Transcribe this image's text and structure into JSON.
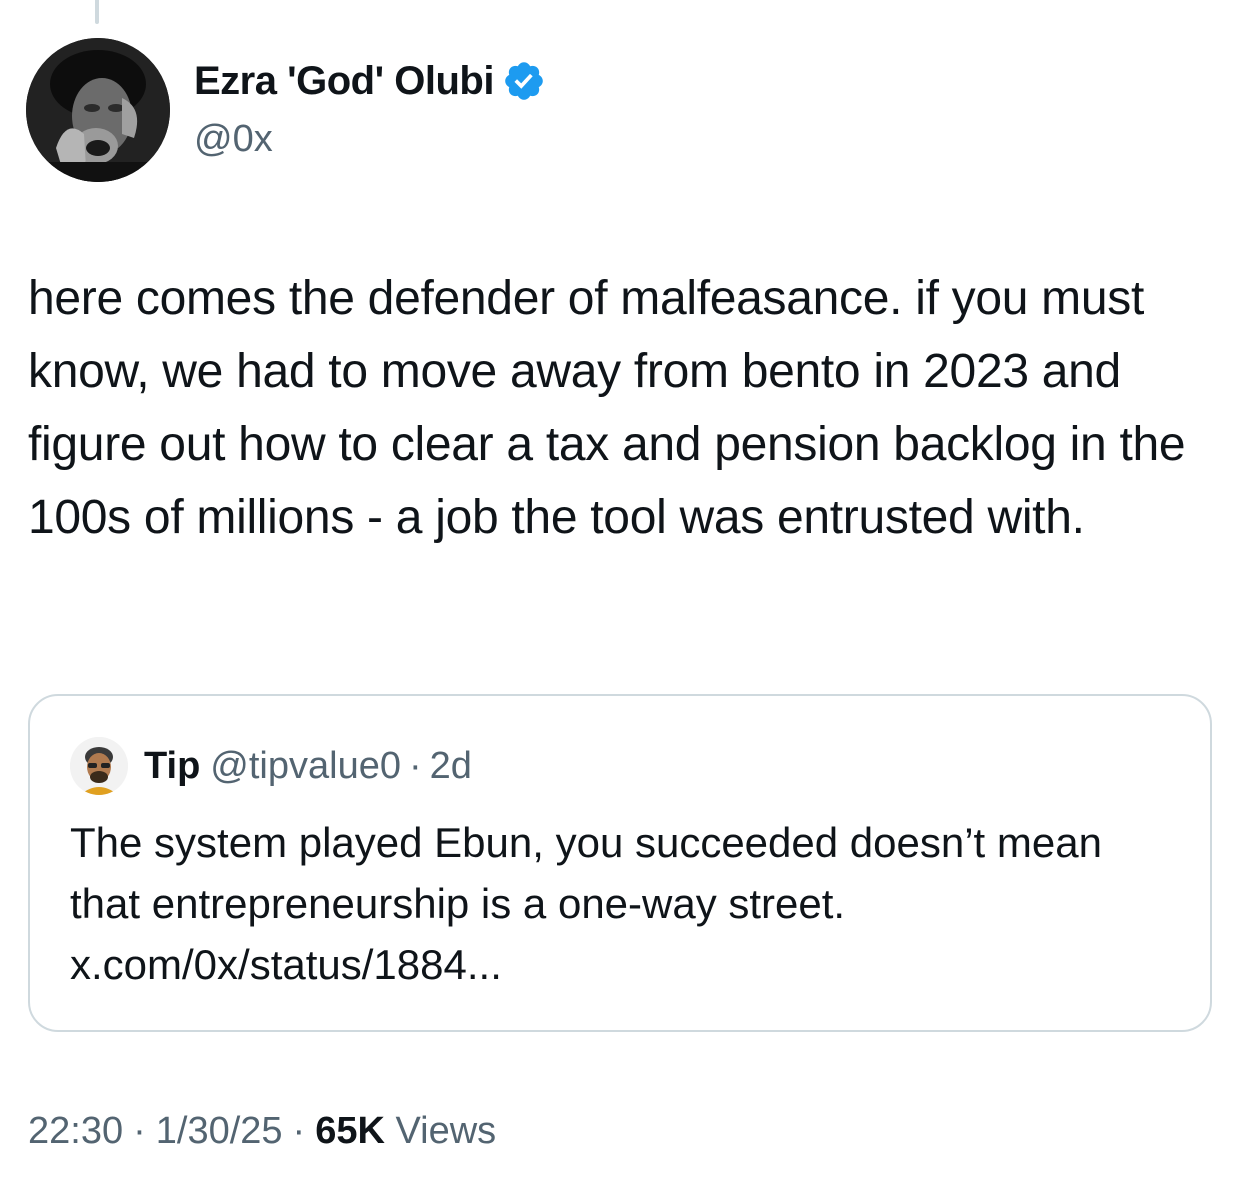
{
  "author": {
    "name": "Ezra 'God' Olubi",
    "handle": "@0x",
    "avatar_icon": "profile-photo-icon",
    "verified_icon": "verified-badge-icon",
    "verified_color": "#1d9bf0"
  },
  "tweet": {
    "text": "here comes the defender of malfeasance. if you must know, we had to move away from bento in 2023 and figure out how to clear a tax and pension backlog in the 100s of millions - a job the tool was entrusted with."
  },
  "quote": {
    "name": "Tip",
    "handle": "@tipvalue0",
    "separator": "·",
    "time": "2d",
    "avatar_icon": "profile-photo-icon",
    "text": "The system played Ebun, you succeeded doesn’t mean that entrepreneurship is a one-way street. x.com/0x/status/1884..."
  },
  "meta": {
    "time": "22:30",
    "date": "1/30/25",
    "separator": "·",
    "views_count": "65K",
    "views_label": "Views"
  },
  "colors": {
    "text_primary": "#0f1419",
    "text_secondary": "#536471",
    "border": "#cfd9de"
  }
}
